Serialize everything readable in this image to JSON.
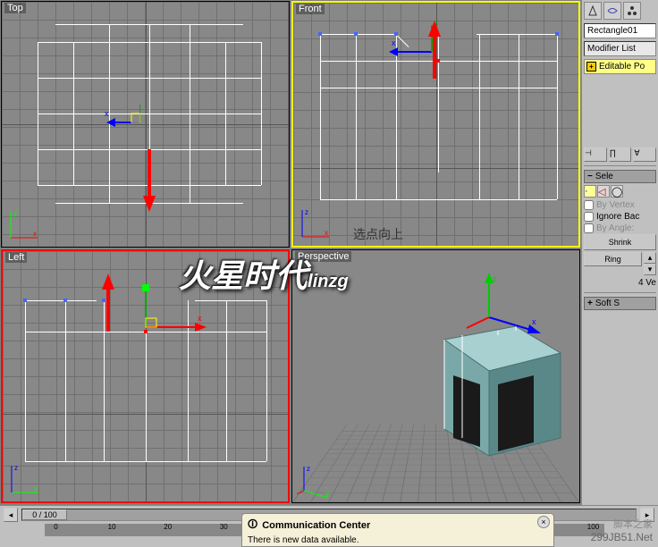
{
  "viewports": {
    "top": {
      "label": "Top"
    },
    "front": {
      "label": "Front"
    },
    "left": {
      "label": "Left"
    },
    "perspective": {
      "label": "Perspective"
    }
  },
  "sidebar": {
    "object_name": "Rectangle01",
    "modifier_label": "Modifier List",
    "stack_item": "Editable Po",
    "selection_header": "Sele",
    "by_vertex": "By Vertex",
    "ignore_back": "Ignore Bac",
    "by_angle": "By Angle:",
    "shrink": "Shrink",
    "ring": "Ring",
    "vert_count": "4 Ve",
    "soft_header": "Soft S"
  },
  "timeline": {
    "position": "0 / 100",
    "ticks": [
      "0",
      "10",
      "20",
      "30",
      "100"
    ]
  },
  "comm_center": {
    "title": "Communication Center",
    "message": "There is new data available."
  },
  "watermark": {
    "main": "火星时代",
    "sub": "linzg",
    "footer1": "299JB51.Net",
    "footer2": "脚本之家"
  },
  "annotation": "选点向上"
}
